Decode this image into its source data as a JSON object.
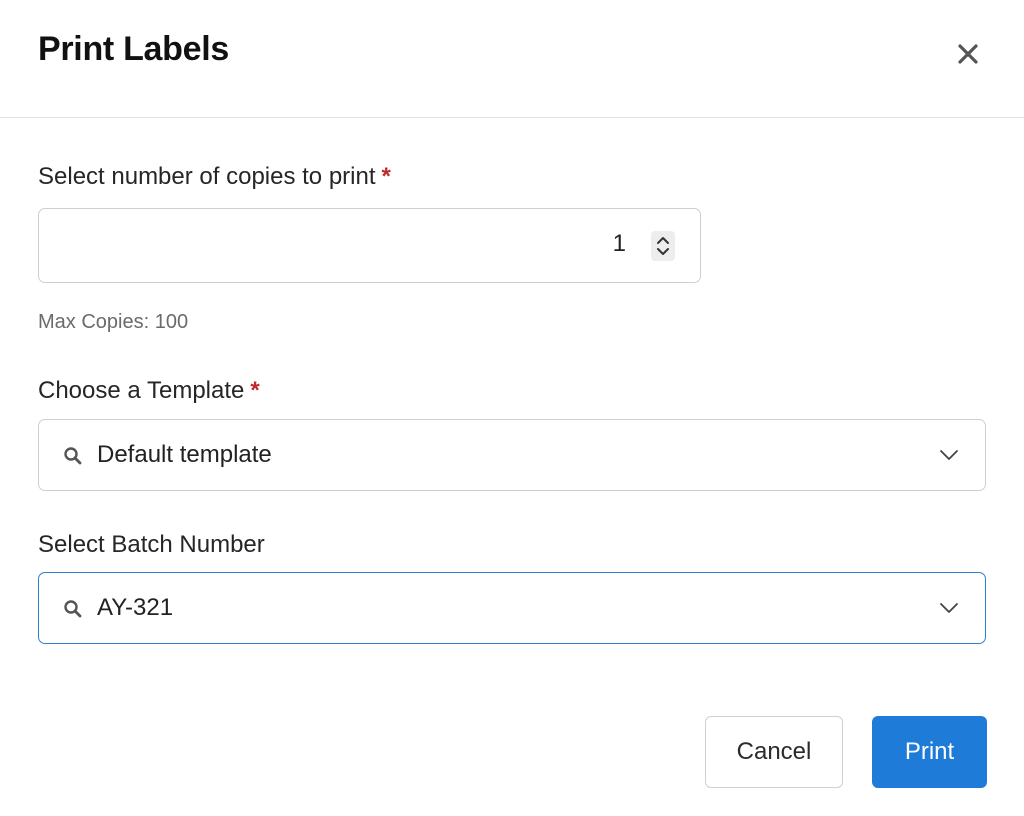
{
  "dialog": {
    "title": "Print Labels",
    "close_icon": "close-icon"
  },
  "copies": {
    "label": "Select number of copies to print",
    "required_mark": "*",
    "value": "1",
    "hint": "Max Copies: 100",
    "spinner_icon": "stepper-icon"
  },
  "template": {
    "label": "Choose a Template",
    "required_mark": "*",
    "value": "Default template",
    "search_icon": "search-icon",
    "chevron_icon": "chevron-down-icon"
  },
  "batch": {
    "label": "Select Batch Number",
    "value": "AY-321",
    "search_icon": "search-icon",
    "chevron_icon": "chevron-down-icon"
  },
  "actions": {
    "cancel_label": "Cancel",
    "print_label": "Print"
  },
  "colors": {
    "primary": "#1f7bd8",
    "required": "#c0282d",
    "focus_border": "#2f7fd1",
    "hint_text": "#6b6b6b"
  }
}
